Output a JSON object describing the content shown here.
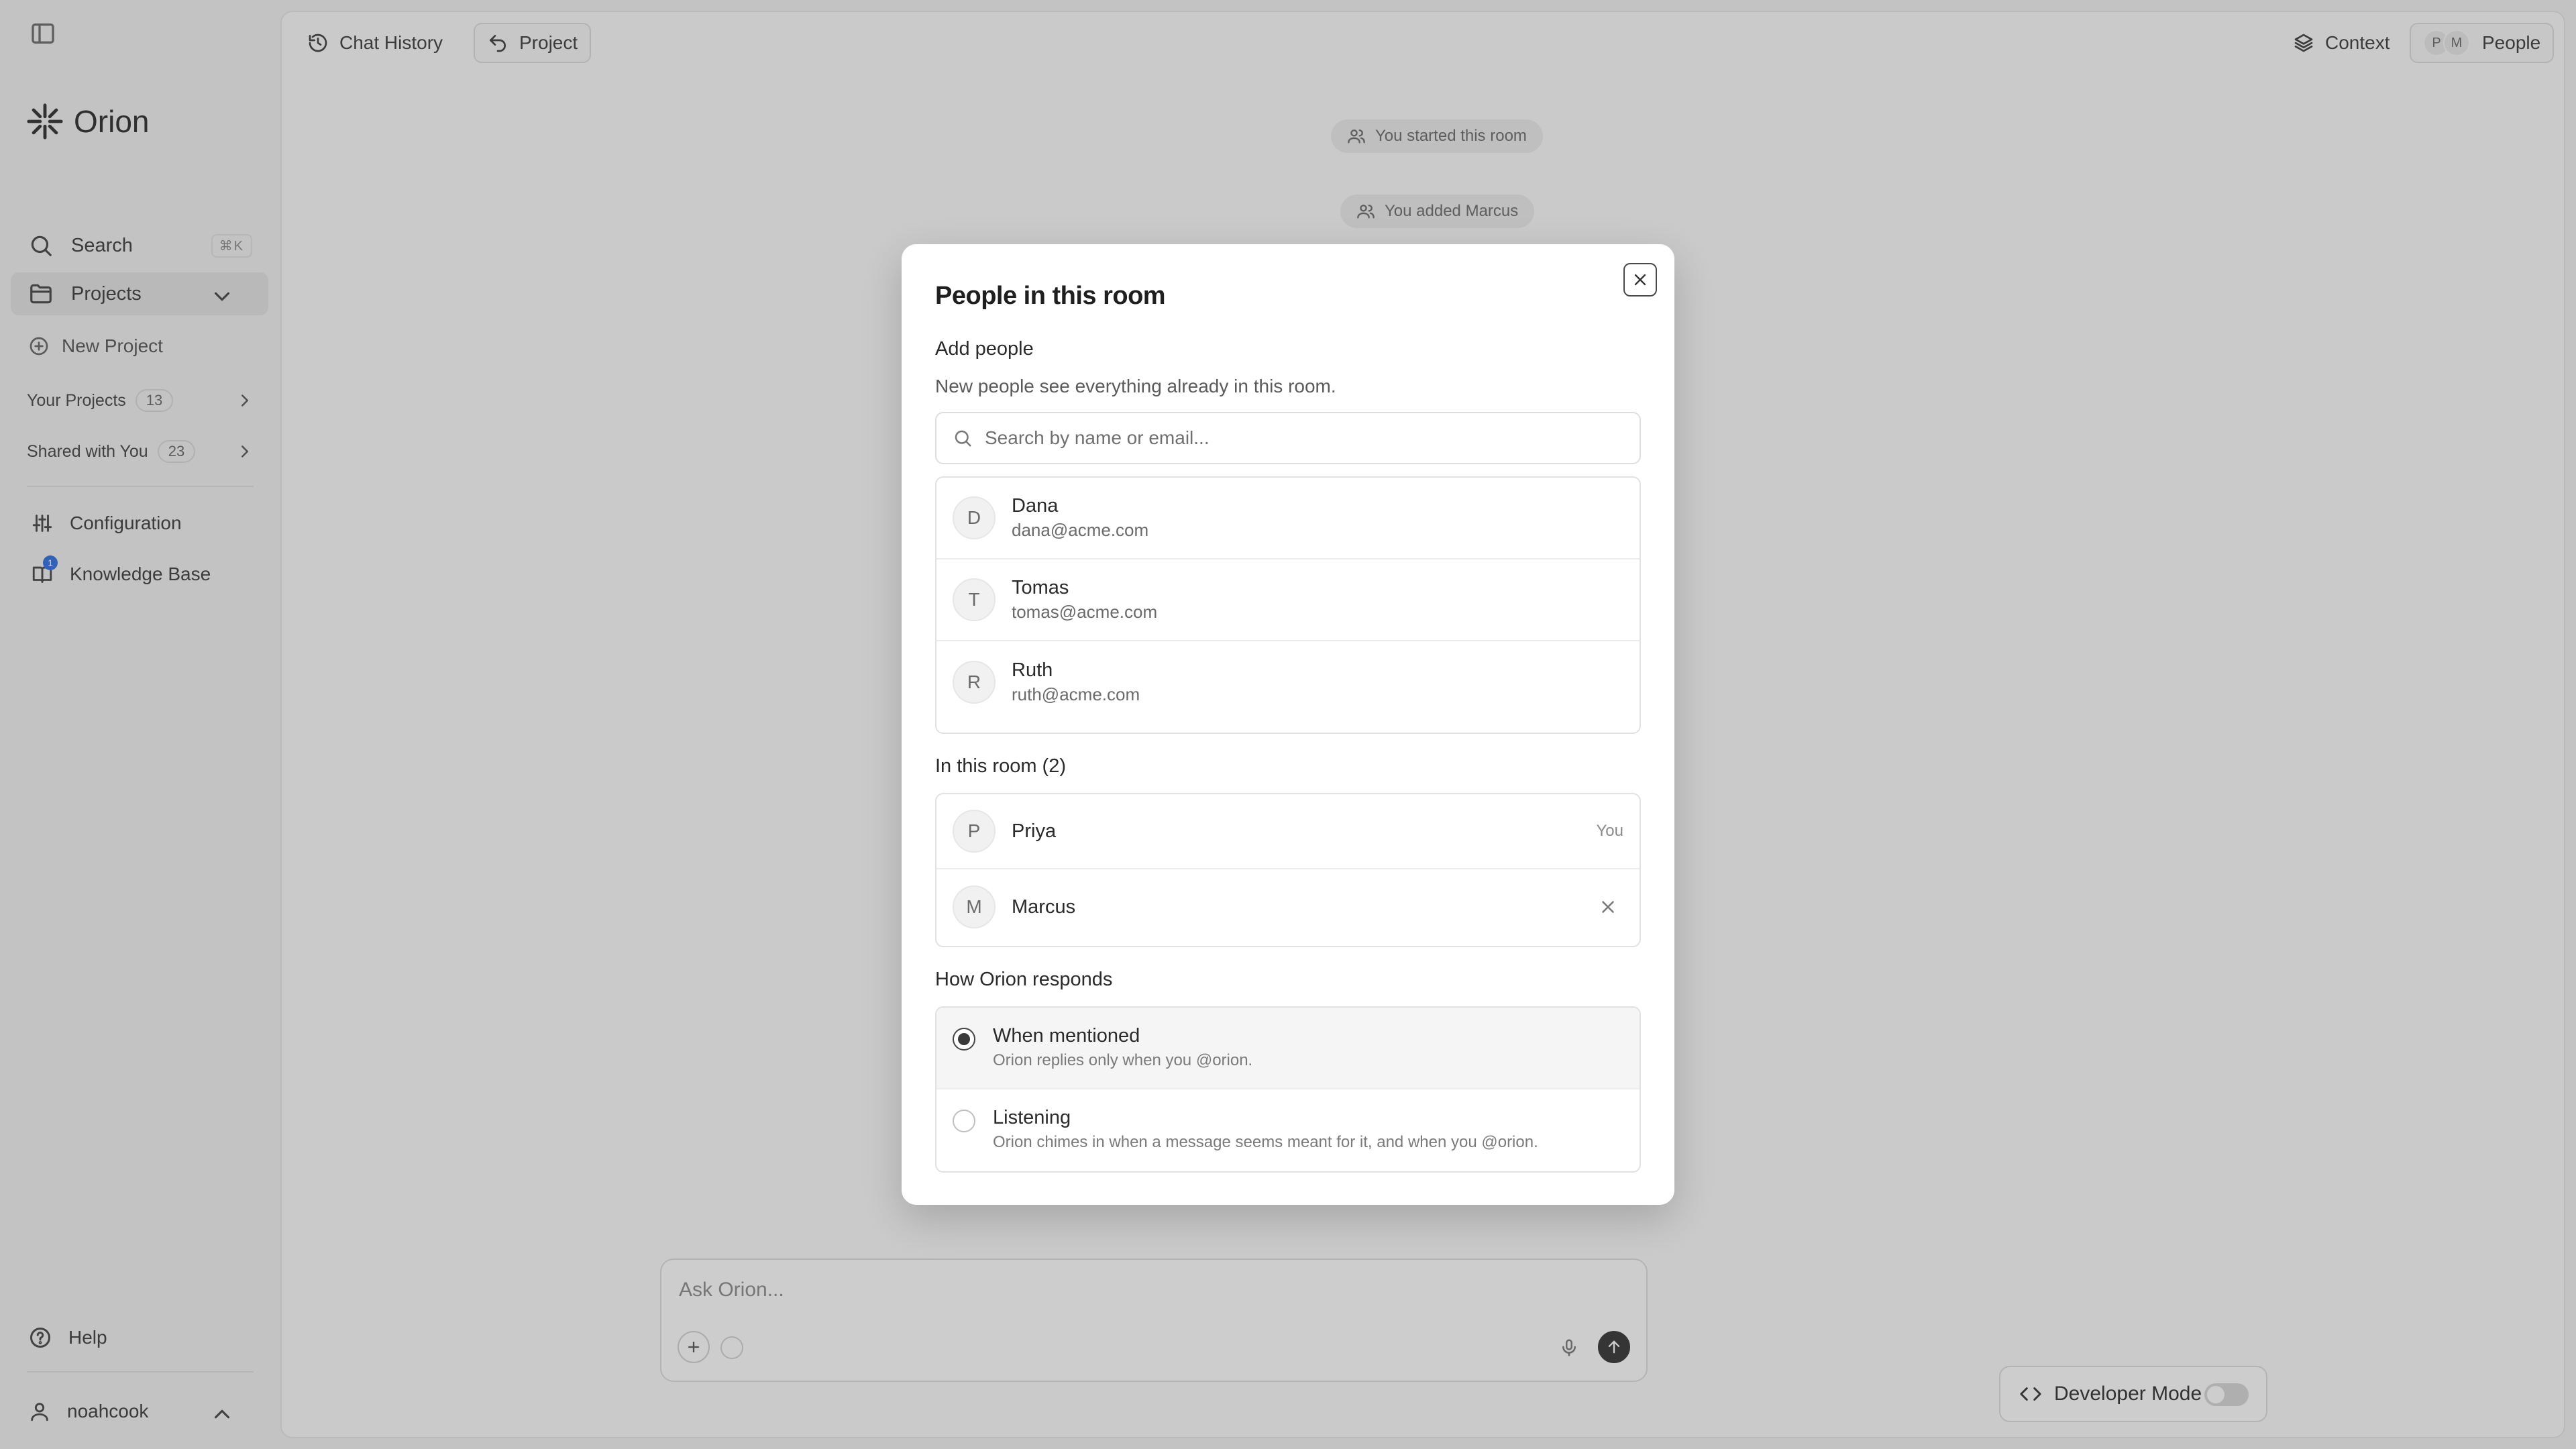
{
  "sidebar": {
    "logo_text": "Orion",
    "search_label": "Search",
    "search_shortcut": "⌘K",
    "projects_label": "Projects",
    "new_project_label": "New Project",
    "your_projects_label": "Your Projects",
    "your_projects_count": "13",
    "shared_label": "Shared with You",
    "shared_count": "23",
    "configuration_label": "Configuration",
    "knowledge_base_label": "Knowledge Base",
    "knowledge_base_badge": "1",
    "help_label": "Help",
    "user_name": "noahcook"
  },
  "topbar": {
    "chat_history_label": "Chat History",
    "project_label": "Project",
    "context_label": "Context",
    "people_label": "People",
    "avatar_initials": [
      "P",
      "M"
    ]
  },
  "timeline": {
    "started": "You started this room",
    "added": "You added Marcus"
  },
  "composer": {
    "placeholder": "Ask Orion..."
  },
  "developer_mode": {
    "label": "Developer Mode",
    "enabled": false
  },
  "modal": {
    "title": "People in this room",
    "add_people_label": "Add people",
    "add_people_hint": "New people see everything already in this room.",
    "search_placeholder": "Search by name or email...",
    "suggestions": [
      {
        "initial": "D",
        "name": "Dana",
        "email": "dana@acme.com"
      },
      {
        "initial": "T",
        "name": "Tomas",
        "email": "tomas@acme.com"
      },
      {
        "initial": "R",
        "name": "Ruth",
        "email": "ruth@acme.com"
      }
    ],
    "in_room_label": "In this room (2)",
    "members": [
      {
        "initial": "P",
        "name": "Priya",
        "tag": "You"
      },
      {
        "initial": "M",
        "name": "Marcus"
      }
    ],
    "responds_label": "How Orion responds",
    "options": [
      {
        "title": "When mentioned",
        "desc": "Orion replies only when you @orion.",
        "selected": true
      },
      {
        "title": "Listening",
        "desc": "Orion chimes in when a message seems meant for it, and when you @orion.",
        "selected": false
      }
    ]
  },
  "colors": {
    "accent_badge": "#2f6fdf",
    "overlay": "#5a5a5a"
  }
}
